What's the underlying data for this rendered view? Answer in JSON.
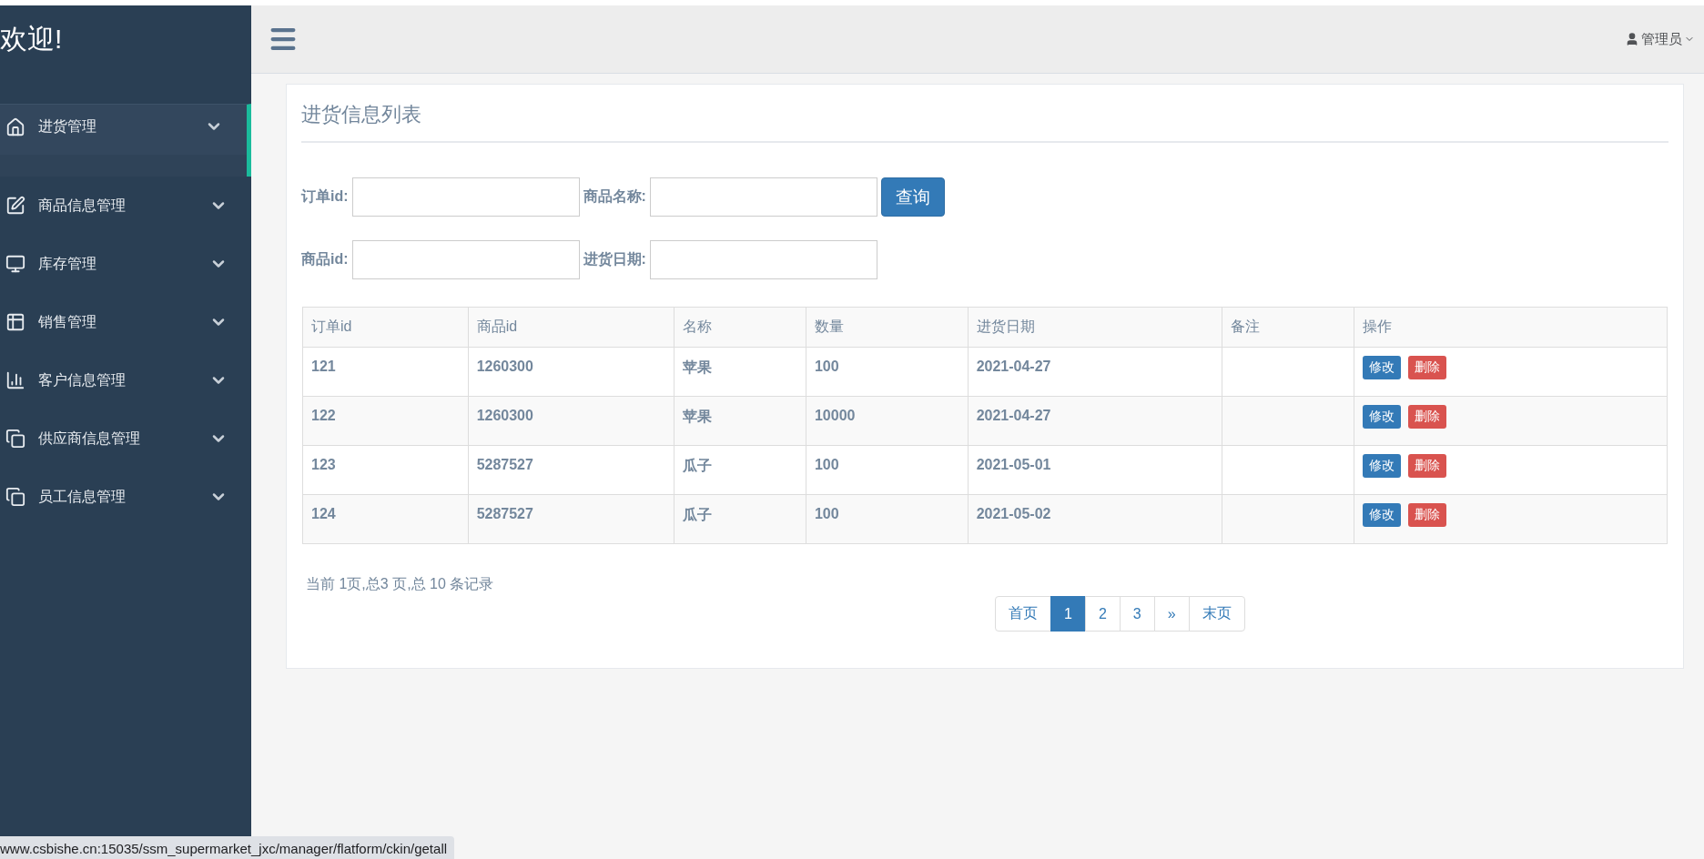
{
  "sidebar": {
    "title": "欢迎!",
    "items": [
      {
        "label": "进货管理",
        "kind": "home",
        "selected": true
      },
      {
        "label": "商品信息管理",
        "kind": "edit",
        "selected": false
      },
      {
        "label": "库存管理",
        "kind": "monitor",
        "selected": false
      },
      {
        "label": "销售管理",
        "kind": "table",
        "selected": false
      },
      {
        "label": "客户信息管理",
        "kind": "chart",
        "selected": false
      },
      {
        "label": "供应商信息管理",
        "kind": "copy",
        "selected": false
      },
      {
        "label": "员工信息管理",
        "kind": "copy",
        "selected": false
      }
    ]
  },
  "header": {
    "user": "管理员"
  },
  "panel": {
    "title": "进货信息列表",
    "filter_rows": [
      [
        {
          "label": "订单id:"
        },
        {
          "label": "商品名称:"
        }
      ],
      [
        {
          "label": "商品id:"
        },
        {
          "label": "进货日期:"
        }
      ]
    ],
    "search_button": "查询",
    "table": {
      "columns": [
        "订单id",
        "商品id",
        "名称",
        "数量",
        "进货日期",
        "备注",
        "操作"
      ],
      "rows": [
        {
          "cells": [
            "121",
            "1260300",
            "苹果",
            "100",
            "2021-04-27",
            ""
          ],
          "actions": [
            {
              "label": "修改",
              "kind": "edit"
            },
            {
              "label": "删除",
              "kind": "delete"
            }
          ]
        },
        {
          "cells": [
            "122",
            "1260300",
            "苹果",
            "10000",
            "2021-04-27",
            ""
          ],
          "actions": [
            {
              "label": "修改",
              "kind": "edit"
            },
            {
              "label": "删除",
              "kind": "delete"
            }
          ]
        },
        {
          "cells": [
            "123",
            "5287527",
            "瓜子",
            "100",
            "2021-05-01",
            ""
          ],
          "actions": [
            {
              "label": "修改",
              "kind": "edit"
            },
            {
              "label": "删除",
              "kind": "delete"
            }
          ]
        },
        {
          "cells": [
            "124",
            "5287527",
            "瓜子",
            "100",
            "2021-05-02",
            ""
          ],
          "actions": [
            {
              "label": "修改",
              "kind": "edit"
            },
            {
              "label": "删除",
              "kind": "delete"
            }
          ]
        }
      ]
    },
    "summary": "当前 1页,总3 页,总 10 条记录",
    "pagination": [
      {
        "label": "首页",
        "selected": false
      },
      {
        "label": "1",
        "selected": true
      },
      {
        "label": "2",
        "selected": false
      },
      {
        "label": "3",
        "selected": false
      },
      {
        "label": "»",
        "selected": false
      },
      {
        "label": "末页",
        "selected": false
      }
    ]
  },
  "status_bar": {
    "url": "www.csbishe.cn:15035/ssm_supermarket_jxc/manager/flatform/ckin/getall"
  }
}
